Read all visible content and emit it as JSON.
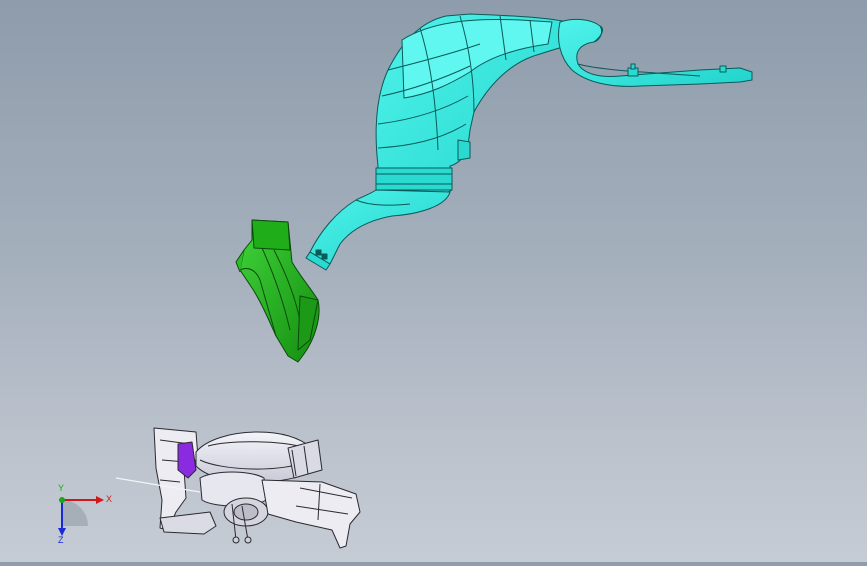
{
  "viewport": {
    "background_top": "#8e9cab",
    "background_bottom": "#c6ccd5"
  },
  "parts": {
    "cyan_duct": {
      "color": "#33e6dd",
      "edge": "#0a5a5a"
    },
    "green_duct": {
      "color": "#22b81c",
      "edge": "#0d4a0b"
    },
    "blower_assembly": {
      "color": "#e4e6ee",
      "edge": "#2a2a30",
      "accent": "#8a2be2"
    }
  },
  "triad": {
    "x_label": "X",
    "y_label": "Y",
    "z_label": "Z",
    "x_color": "#d01818",
    "y_color": "#18a818",
    "z_color": "#1a2ad8"
  }
}
